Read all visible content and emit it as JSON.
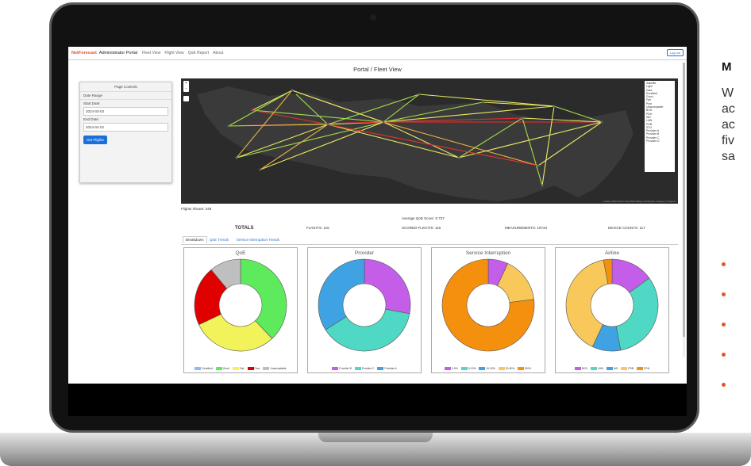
{
  "header": {
    "brand": "NetForecast",
    "brand_sub": "Administrator Portal",
    "nav": [
      "Fleet View",
      "Flight View",
      "QoE Report",
      "About"
    ],
    "logout": "Log out"
  },
  "page_title": "Portal / Fleet View",
  "controls": {
    "title": "Page Controls",
    "date_range": "Date Range",
    "start_label": "Start Date:",
    "start_value": "2024-03-03",
    "end_label": "End Date:",
    "end_value": "2024-04-02",
    "button": "Get Flights"
  },
  "map": {
    "zoom_in": "+",
    "zoom_out": "−",
    "layers": [
      "Satellite",
      "Light",
      "Dark",
      "Excellent",
      "Good",
      "Fair",
      "Poor",
      "Unacceptable",
      "BCD",
      "PDH",
      "IAD",
      "LMN",
      "PDB",
      "STU",
      "Provider A",
      "Provider B",
      "Provider C",
      "Provider D"
    ],
    "attribution": "Leaflet | Map data © OpenStreetMap contributors, Imagery © Mapbox"
  },
  "summary": {
    "flights_shown": "Flights Shown: 348",
    "avg_score": "Average QoE Score: 0.737",
    "totals_label": "TOTALS",
    "flights": "FLIGHTS: 116",
    "scored": "SCORED FLIGHTS: 116",
    "measurements": "MEASUREMENTS: 19743",
    "devices": "DEVICE COUNTS: 117"
  },
  "tabs": [
    "Breakdown",
    "QoE Trends",
    "Service Interruption Trends"
  ],
  "charts": [
    {
      "title": "QoE",
      "legend": [
        "Excellent",
        "Good",
        "Fair",
        "Poor",
        "Unacceptable"
      ],
      "colors": [
        "#8fbcf0",
        "#5dea5d",
        "#f2f25a",
        "#e00000",
        "#bfbfbf"
      ]
    },
    {
      "title": "Provider",
      "legend": [
        "Provider B",
        "Provider C",
        "Provider A"
      ],
      "colors": [
        "#c45ee8",
        "#4fd8c4",
        "#3fa2e2"
      ]
    },
    {
      "title": "Service Interruption",
      "legend": [
        "0-5%",
        "5-10%",
        "10-20%",
        "20-50%",
        "50%+"
      ],
      "colors": [
        "#c45ee8",
        "#4fd8c4",
        "#3fa2e2",
        "#f8c85a",
        "#f5900f"
      ]
    },
    {
      "title": "Airline",
      "legend": [
        "BCD",
        "LMN",
        "IAD",
        "PDB",
        "PDH"
      ],
      "colors": [
        "#c45ee8",
        "#4fd8c4",
        "#3fa2e2",
        "#f8c85a",
        "#f5900f"
      ]
    }
  ],
  "chart_data": [
    {
      "type": "pie",
      "title": "QoE",
      "categories": [
        "Excellent",
        "Good",
        "Fair",
        "Poor",
        "Unacceptable"
      ],
      "values": [
        0,
        38,
        30,
        21,
        11
      ]
    },
    {
      "type": "pie",
      "title": "Provider",
      "categories": [
        "Provider B",
        "Provider C",
        "Provider A"
      ],
      "values": [
        28,
        38,
        34
      ]
    },
    {
      "type": "pie",
      "title": "Service Interruption",
      "categories": [
        "0-5%",
        "5-10%",
        "10-20%",
        "20-50%",
        "50%+"
      ],
      "values": [
        7,
        0,
        0,
        16,
        77
      ]
    },
    {
      "type": "pie",
      "title": "Airline",
      "categories": [
        "BCD",
        "LMN",
        "IAD",
        "PDB",
        "PDH"
      ],
      "values": [
        15,
        32,
        10,
        40,
        3
      ]
    }
  ],
  "side_panel": {
    "title": "M",
    "lines": [
      "W",
      "ac",
      "ac",
      "fiv",
      "sa"
    ]
  }
}
